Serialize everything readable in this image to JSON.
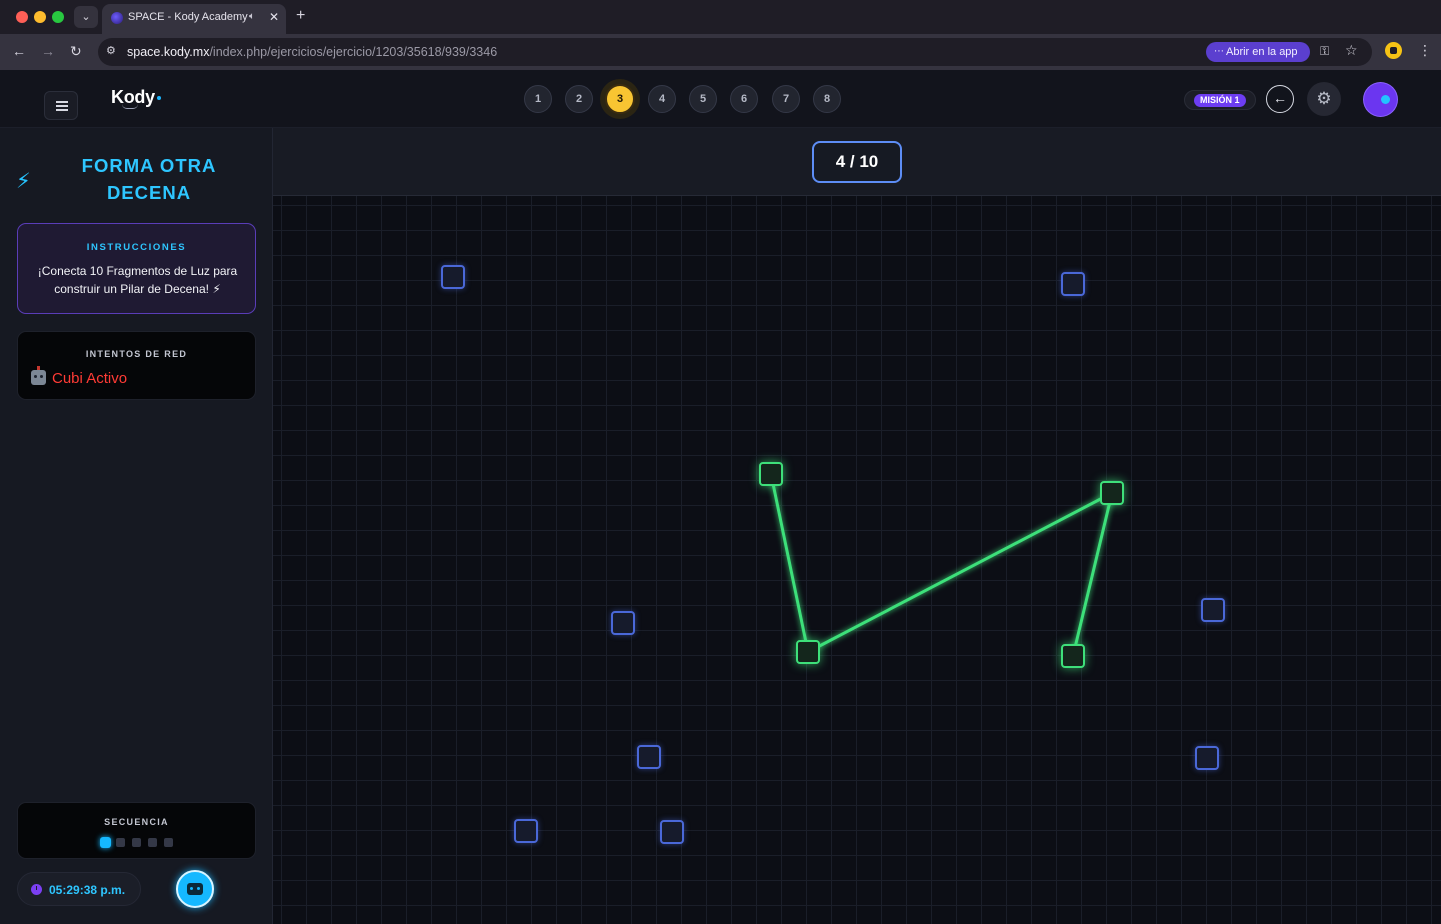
{
  "browser": {
    "tab_title": "SPACE - Kody Academy",
    "url_host": "space.kody.mx",
    "url_path": "/index.php/ejercicios/ejercicio/1203/35618/939/3346",
    "open_app_label": "Abrir en la app"
  },
  "header": {
    "logo": "Kody",
    "levels": [
      "1",
      "2",
      "3",
      "4",
      "5",
      "6",
      "7",
      "8"
    ],
    "active_level": "3",
    "mission_label": "MISIÓN 1"
  },
  "sidebar": {
    "title": "FORMA OTRA DECENA",
    "instructions_label": "INSTRUCCIONES",
    "instructions_text": "¡Conecta 10 Fragmentos de Luz para construir un Pilar de Decena! ⚡",
    "network_label": "INTENTOS DE RED",
    "network_status": "Cubi Activo",
    "sequence_label": "SECUENCIA",
    "sequence_total": 5,
    "sequence_active": 1,
    "clock": "05:29:38 p.m."
  },
  "board": {
    "counter": "4 / 10",
    "connected_count": 4,
    "target_count": 10
  },
  "colors": {
    "accent_cyan": "#2ec6ff",
    "node_blue": "#4a68d8",
    "link_green": "#3ee07a",
    "level_active": "#f8c532",
    "status_red": "#ff3b35"
  }
}
